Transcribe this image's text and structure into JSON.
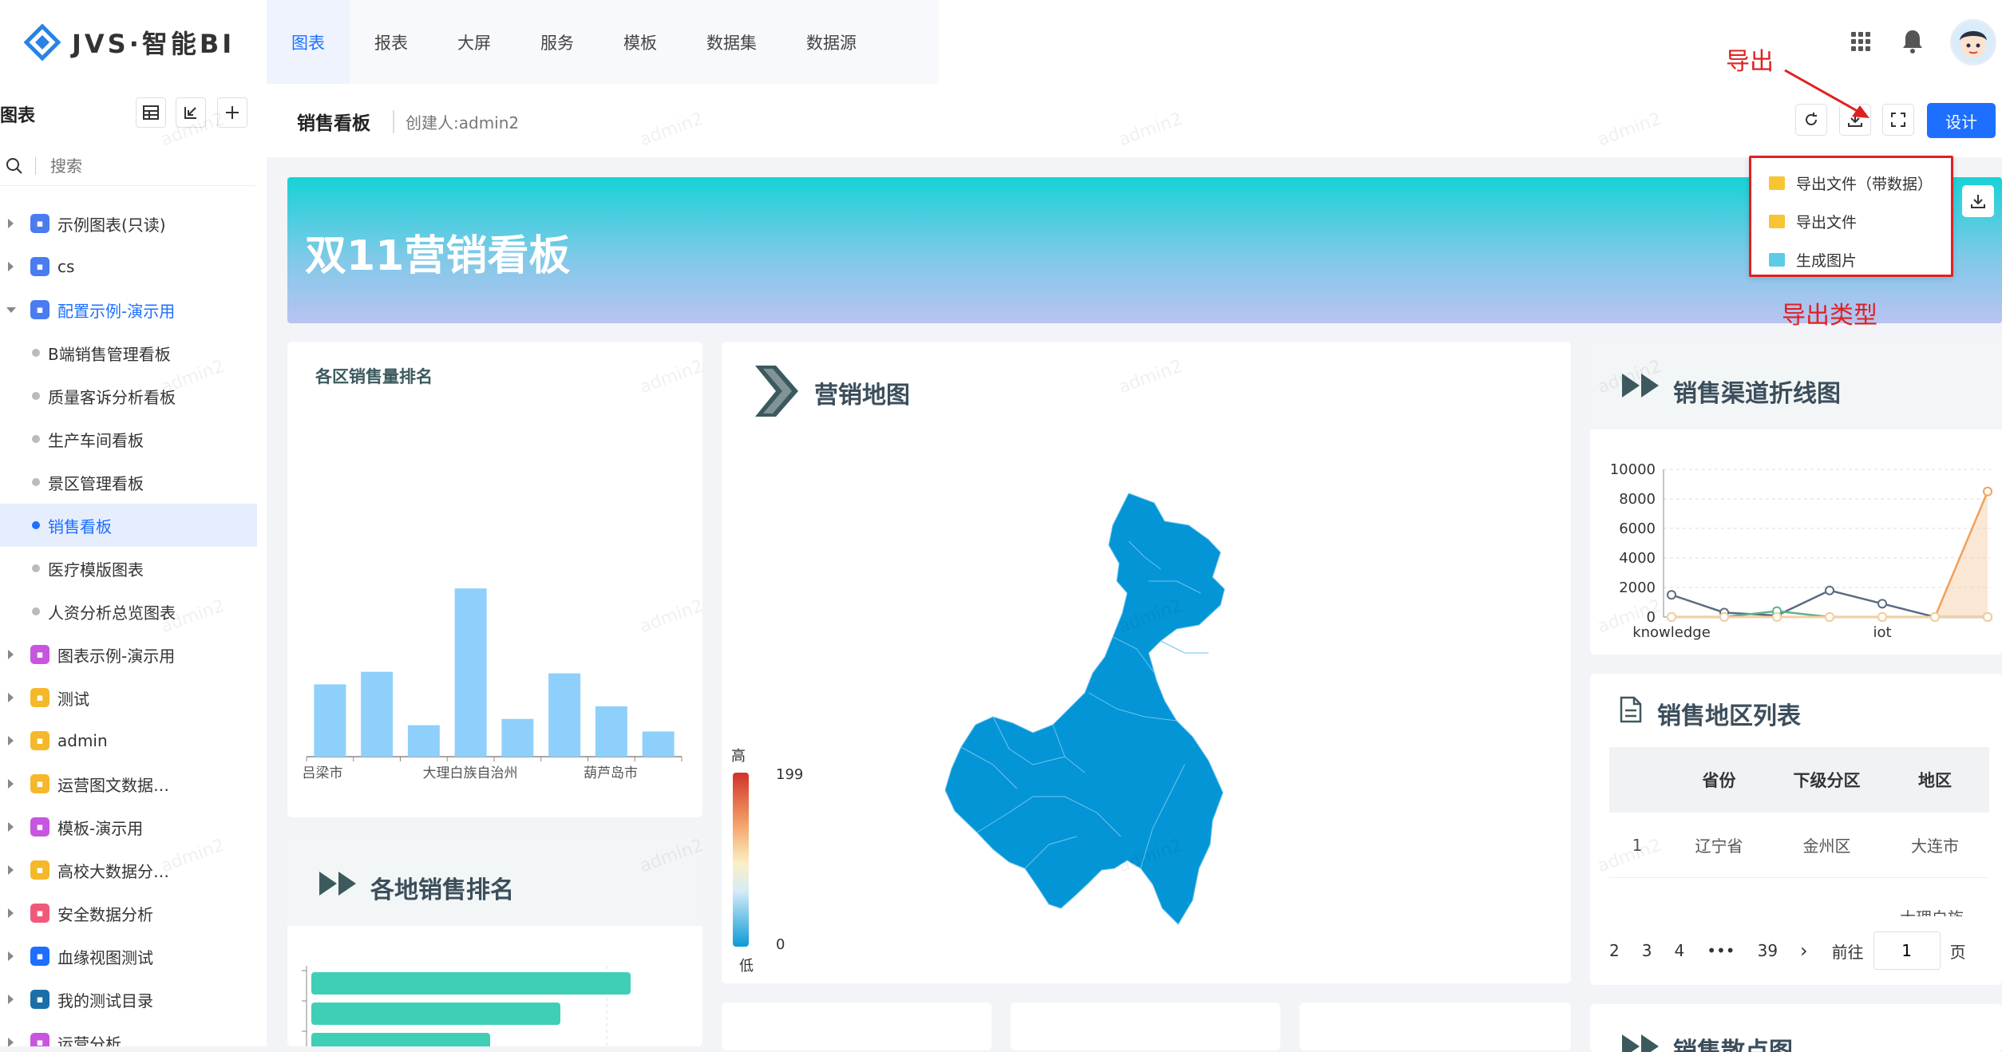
{
  "app": {
    "logo_text": "JVS·智能BI"
  },
  "nav": {
    "items": [
      "图表",
      "报表",
      "大屏",
      "服务",
      "模板",
      "数据集",
      "数据源"
    ],
    "active": "图表"
  },
  "sidebar": {
    "title": "图表",
    "search_placeholder": "搜索",
    "tree": [
      {
        "label": "示例图表(只读)",
        "type": "folder",
        "icon_color": "#4a7cf0",
        "expanded": false
      },
      {
        "label": "cs",
        "type": "folder",
        "icon_color": "#4a7cf0",
        "expanded": false
      },
      {
        "label": "配置示例-演示用",
        "type": "folder",
        "icon_color": "#4a7cf0",
        "expanded": true,
        "highlight": true
      },
      {
        "label": "B端销售管理看板",
        "type": "leaf"
      },
      {
        "label": "质量客诉分析看板",
        "type": "leaf"
      },
      {
        "label": "生产车间看板",
        "type": "leaf"
      },
      {
        "label": "景区管理看板",
        "type": "leaf"
      },
      {
        "label": "销售看板",
        "type": "leaf",
        "active": true
      },
      {
        "label": "医疗模版图表",
        "type": "leaf"
      },
      {
        "label": "人资分析总览图表",
        "type": "leaf"
      },
      {
        "label": "图表示例-演示用",
        "type": "folder",
        "icon_color": "#c855e0",
        "expanded": false
      },
      {
        "label": "测试",
        "type": "folder",
        "icon_color": "#f5b82a",
        "expanded": false
      },
      {
        "label": "admin",
        "type": "folder",
        "icon_color": "#f5b82a",
        "expanded": false
      },
      {
        "label": "运营图文数据…",
        "type": "folder",
        "icon_color": "#f5b82a",
        "expanded": false
      },
      {
        "label": "模板-演示用",
        "type": "folder",
        "icon_color": "#c855e0",
        "expanded": false
      },
      {
        "label": "高校大数据分…",
        "type": "folder",
        "icon_color": "#f5b82a",
        "expanded": false
      },
      {
        "label": "安全数据分析",
        "type": "folder",
        "icon_color": "#f05a78",
        "expanded": false
      },
      {
        "label": "血缘视图测试",
        "type": "folder",
        "icon_color": "#1e6fff",
        "expanded": false
      },
      {
        "label": "我的测试目录",
        "type": "folder",
        "icon_color": "#1b6fa8",
        "expanded": false
      },
      {
        "label": "运营分析",
        "type": "folder",
        "icon_color": "#c855e0",
        "expanded": false
      }
    ]
  },
  "header": {
    "board_title": "销售看板",
    "creator": "创建人:admin2",
    "design_label": "设计"
  },
  "banner": {
    "title": "双11营销看板"
  },
  "export": {
    "menu_items": [
      "导出文件（带数据）",
      "导出文件",
      "生成图片"
    ],
    "annotation_export": "导出",
    "annotation_type": "导出类型"
  },
  "watermark": "admin2",
  "cards": {
    "sales_rank": {
      "title": "各区销售量排名"
    },
    "map": {
      "title": "营销地图",
      "legend_high": "高",
      "legend_low": "低",
      "legend_max": "199",
      "legend_min": "0"
    },
    "channel": {
      "title": "销售渠道折线图"
    },
    "local_rank": {
      "title": "各地销售排名"
    },
    "region_list": {
      "title": "销售地区列表"
    },
    "scatter": {
      "title": "销售散点图"
    }
  },
  "region_table": {
    "headers": [
      "",
      "省份",
      "下级分区",
      "地区"
    ],
    "rows": [
      [
        "1",
        "辽宁省",
        "金州区",
        "大连市"
      ]
    ],
    "partial_text": "大理白族",
    "pagination": {
      "pages": [
        "2",
        "3",
        "4",
        "•••",
        "39"
      ],
      "goto_label": "前往",
      "goto_value": "1",
      "page_suffix": "页"
    }
  },
  "chart_data": [
    {
      "type": "bar",
      "title": "各区销售量排名",
      "categories": [
        "吕梁市",
        "",
        "",
        "大理白族自治州",
        "",
        "",
        "葫芦岛市",
        "",
        ""
      ],
      "tick_labels": [
        "吕梁市",
        "大理白族自治州",
        "葫芦岛市"
      ],
      "values": [
        46,
        54,
        20,
        107,
        24,
        53,
        32,
        16
      ],
      "color": "#8ed0fb"
    },
    {
      "type": "line",
      "title": "销售渠道折线图",
      "x_tick_labels": [
        "knowledge",
        "iot"
      ],
      "y_ticks": [
        0,
        2000,
        4000,
        6000,
        8000,
        10000
      ],
      "ylim": [
        0,
        10000
      ],
      "series": [
        {
          "color": "#5a6b82",
          "values": [
            1500,
            300,
            100,
            1800,
            900,
            0,
            0
          ]
        },
        {
          "color": "#5fb38c",
          "values": [
            0,
            0,
            400,
            0,
            0,
            0,
            0
          ]
        },
        {
          "color": "#f0a05a",
          "values": [
            0,
            0,
            0,
            0,
            0,
            0,
            8500
          ]
        },
        {
          "color": "#f5cfa2",
          "values": [
            0,
            0,
            0,
            0,
            0,
            0,
            0
          ]
        }
      ]
    },
    {
      "type": "bar",
      "title": "各地销售排名",
      "orientation": "horizontal",
      "values": [
        100,
        78,
        56
      ],
      "color": "#3fcfb6"
    }
  ]
}
